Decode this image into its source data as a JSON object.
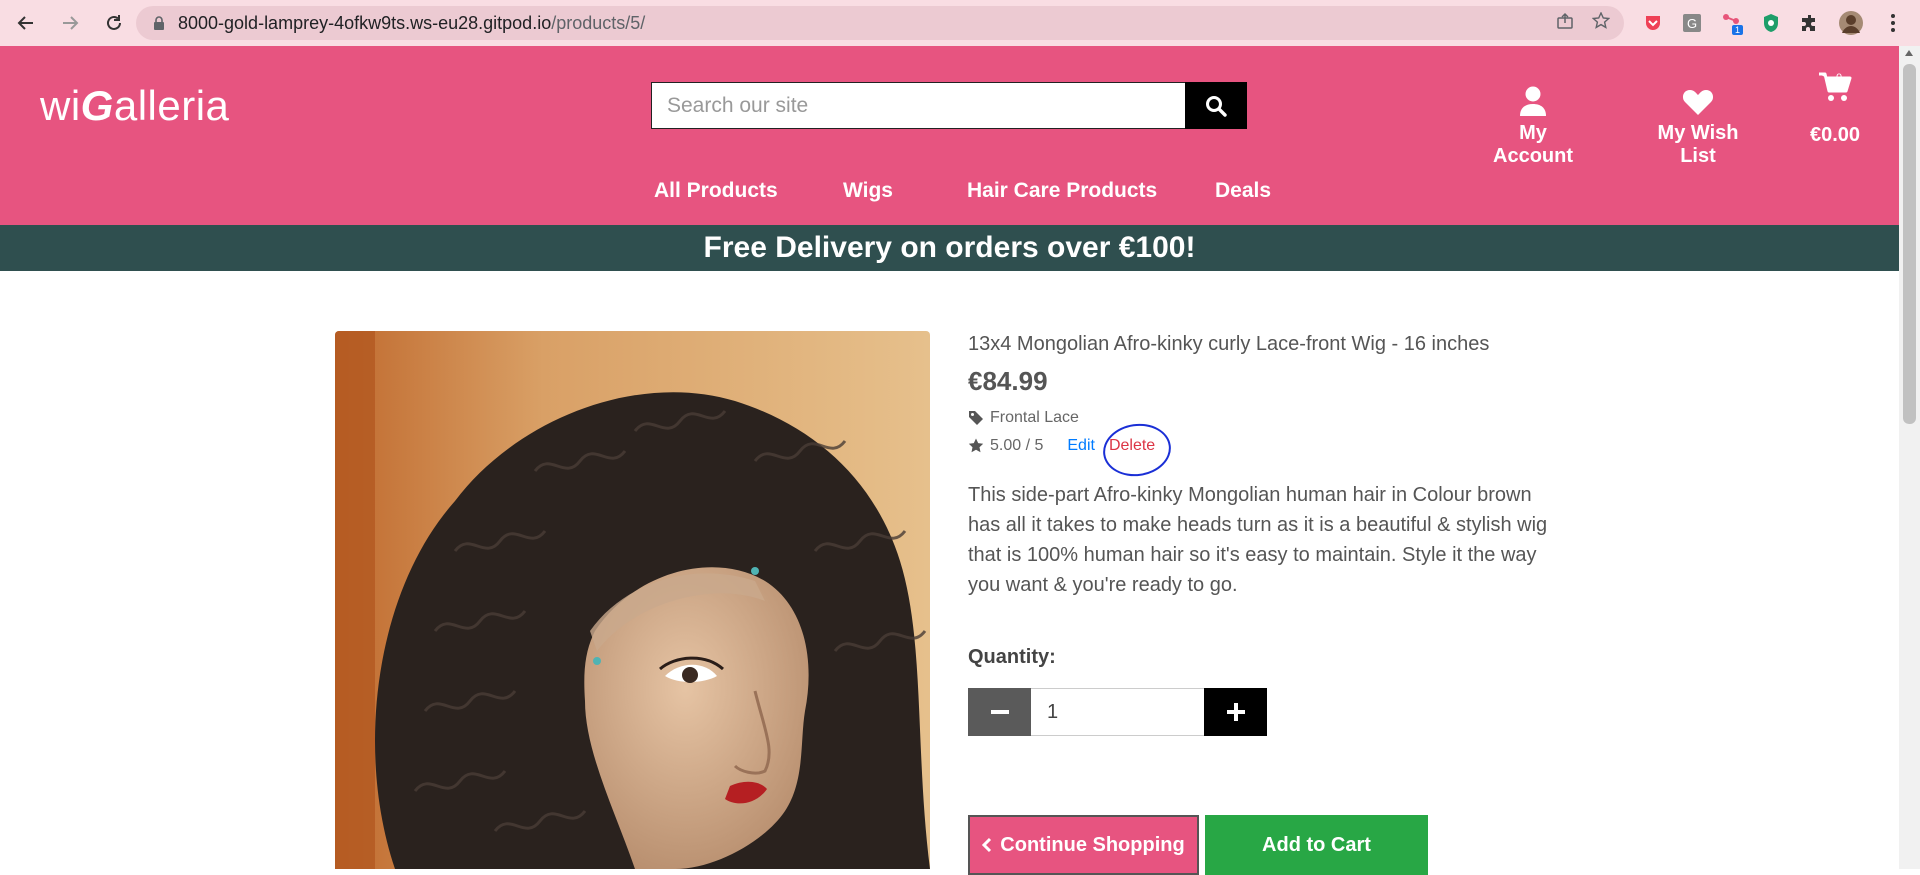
{
  "browser": {
    "url_host": "8000-gold-lamprey-4ofkw9ts.ws-eu28.gitpod.io",
    "url_path": "/products/5/",
    "extension_badge": "1",
    "icons": [
      "back-icon",
      "forward-icon",
      "reload-icon",
      "lock-icon",
      "share-icon",
      "star-icon",
      "extension-icon",
      "profile-avatar"
    ]
  },
  "site": {
    "logo_prefix": "wi",
    "logo_g": "G",
    "logo_suffix": "alleria",
    "search_placeholder": "Search our site",
    "my_account": "My Account",
    "wish_list": "My Wish List",
    "cart_total": "€0.00",
    "cart_count": "0",
    "nav": [
      "All Products",
      "Wigs",
      "Hair Care Products",
      "Deals"
    ],
    "banner": "Free Delivery on orders over €100!",
    "brand_color": "#e75480",
    "banner_color": "#2f4f4f"
  },
  "product": {
    "name": "13x4 Mongolian Afro-kinky curly Lace-front Wig - 16 inches",
    "price": "€84.99",
    "category": "Frontal Lace",
    "rating": "5.00 / 5",
    "edit_label": "Edit",
    "delete_label": "Delete",
    "description": "This side-part Afro-kinky Mongolian human hair in Colour brown has all it takes to make heads turn as it is a beautiful & stylish wig that is 100% human hair so it's easy to maintain. Style it the way you want & you're ready to go.",
    "quantity_label": "Quantity:",
    "quantity_value": "1",
    "continue_label": "Continue Shopping",
    "add_label": "Add to Cart"
  }
}
